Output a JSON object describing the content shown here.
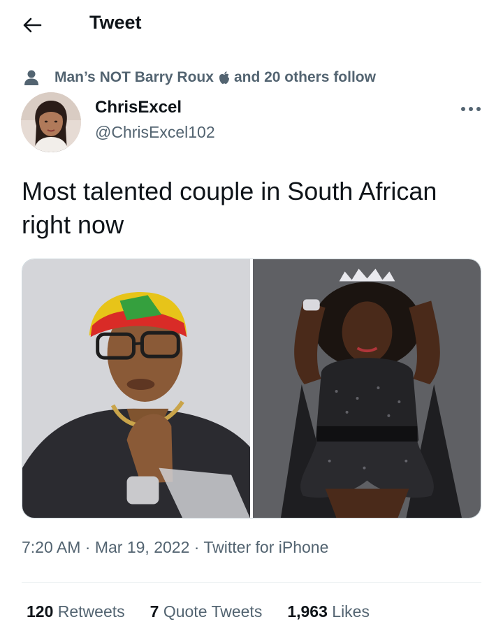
{
  "header": {
    "title": "Tweet",
    "back_icon": "arrow-left-icon"
  },
  "social_context": {
    "prefix": "Man’s NOT Barry Roux",
    "suffix": "and 20 others follow",
    "person_icon": "person-icon",
    "inline_icon": "apple-icon"
  },
  "author": {
    "display_name": "ChrisExcel",
    "handle": "@ChrisExcel102",
    "more_icon": "more-horizontal-icon"
  },
  "tweet": {
    "text": "Most talented couple in South African right now"
  },
  "media": {
    "photos": [
      "photo-left",
      "photo-right"
    ]
  },
  "meta": {
    "time": "7:20 AM",
    "date": "Mar 19, 2022",
    "source": "Twitter for iPhone",
    "separator": " · "
  },
  "stats": {
    "retweets_count": "120",
    "retweets_label": "Retweets",
    "quotes_count": "7",
    "quotes_label": "Quote Tweets",
    "likes_count": "1,963",
    "likes_label": "Likes"
  },
  "colors": {
    "text_primary": "#0f1419",
    "text_secondary": "#536471",
    "border": "#cfd9de",
    "divider": "#eff3f4",
    "background": "#ffffff"
  }
}
